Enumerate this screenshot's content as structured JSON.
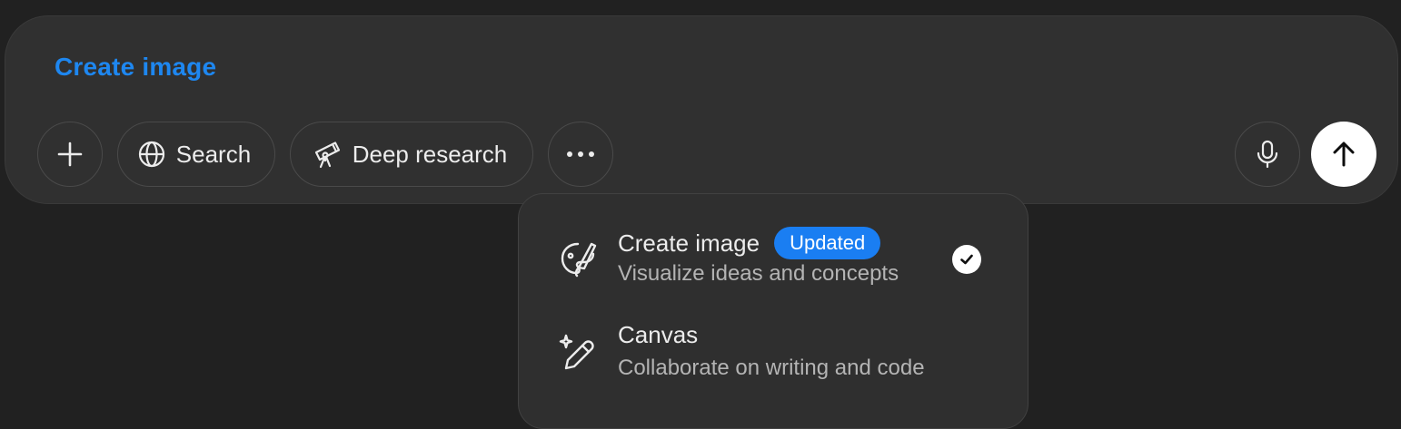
{
  "composer": {
    "active_mode": "Create image",
    "buttons": {
      "add_icon": "plus-icon",
      "search_label": "Search",
      "search_icon": "globe-icon",
      "deep_research_label": "Deep research",
      "deep_research_icon": "telescope-icon",
      "more_icon": "ellipsis-icon",
      "mic_icon": "microphone-icon",
      "send_icon": "arrow-up-icon"
    }
  },
  "menu": {
    "items": [
      {
        "title": "Create image",
        "badge": "Updated",
        "subtitle": "Visualize ideas and concepts",
        "icon": "paint-palette-icon",
        "selected": true
      },
      {
        "title": "Canvas",
        "subtitle": "Collaborate on writing and code",
        "icon": "pencil-sparkle-icon",
        "selected": false
      }
    ]
  },
  "colors": {
    "background": "#212121",
    "composer": "#303030",
    "accent": "#1e87f0",
    "badge": "#1a7ef2"
  }
}
